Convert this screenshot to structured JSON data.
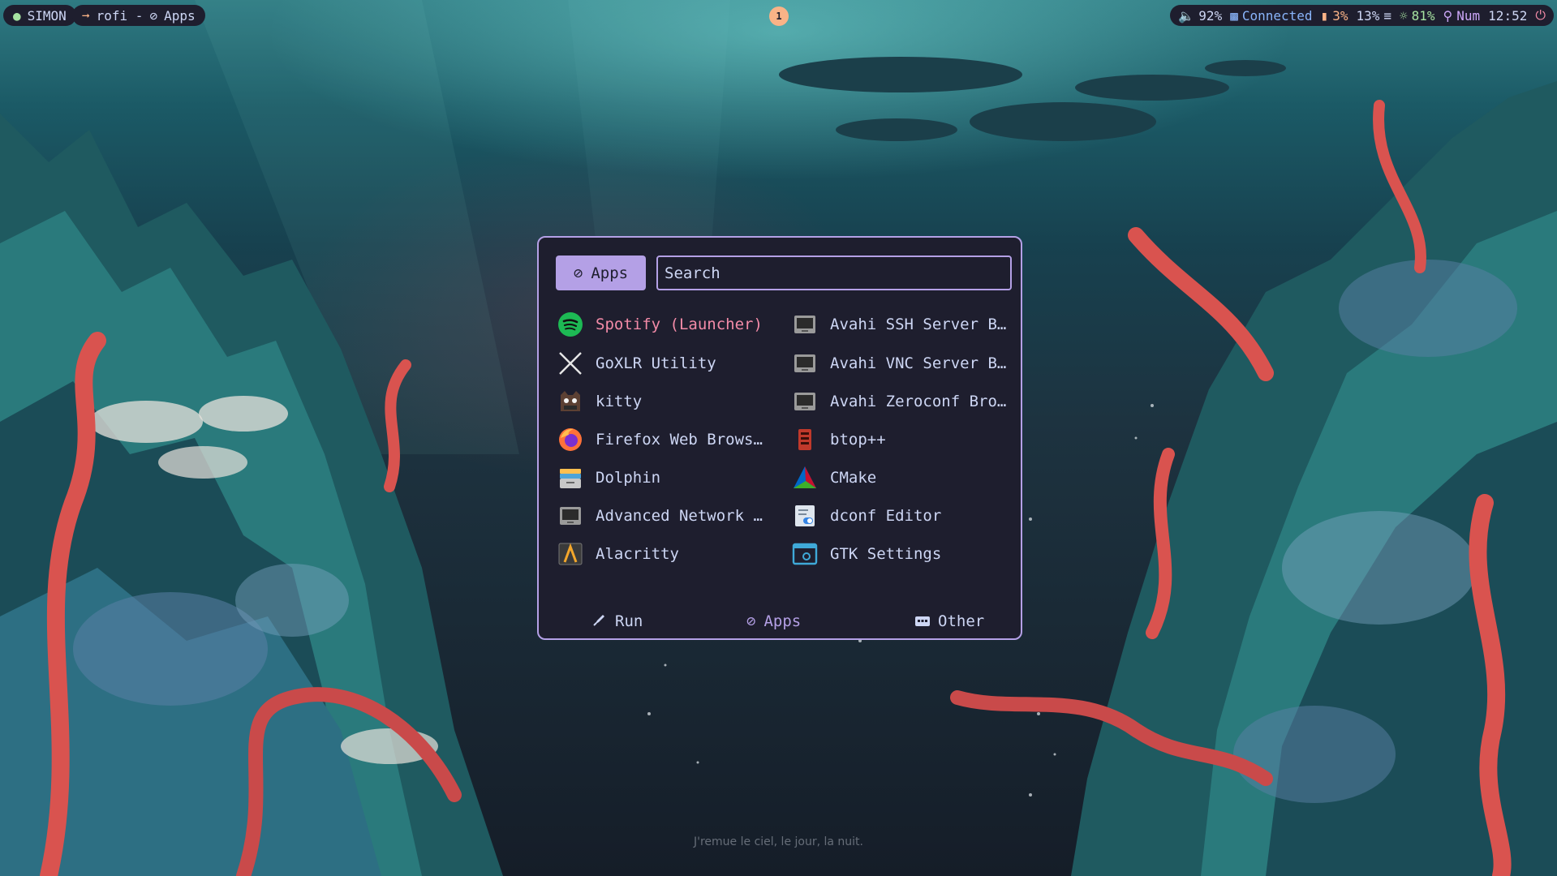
{
  "topbar": {
    "user": "SIMON",
    "window": {
      "prefix": "rofi -",
      "mode": "Apps"
    },
    "workspace": "1",
    "status": {
      "volume": "92%",
      "network": "Connected",
      "cpu": "3%",
      "memory": "13%",
      "brightness": "81%",
      "numlock": "Num",
      "clock": "12:52"
    }
  },
  "rofi": {
    "mode_label": "Apps",
    "search_placeholder": "Search",
    "apps_left": [
      {
        "label": "Spotify (Launcher)",
        "icon": "spotify-icon",
        "selected": true
      },
      {
        "label": "GoXLR Utility",
        "icon": "goxlr-icon"
      },
      {
        "label": "kitty",
        "icon": "kitty-icon"
      },
      {
        "label": "Firefox Web Browser",
        "icon": "firefox-icon"
      },
      {
        "label": "Dolphin",
        "icon": "dolphin-icon"
      },
      {
        "label": "Advanced Network Co…",
        "icon": "network-icon"
      },
      {
        "label": "Alacritty",
        "icon": "alacritty-icon"
      }
    ],
    "apps_right": [
      {
        "label": "Avahi SSH Server Br…",
        "icon": "avahi-icon"
      },
      {
        "label": "Avahi VNC Server Br…",
        "icon": "avahi-icon"
      },
      {
        "label": "Avahi Zeroconf Brow…",
        "icon": "avahi-icon"
      },
      {
        "label": "btop++",
        "icon": "btop-icon"
      },
      {
        "label": "CMake",
        "icon": "cmake-icon"
      },
      {
        "label": "dconf Editor",
        "icon": "dconf-icon"
      },
      {
        "label": "GTK Settings",
        "icon": "gtk-settings-icon"
      }
    ],
    "modes": [
      {
        "label": "Run",
        "icon": "rocket-icon"
      },
      {
        "label": "Apps",
        "icon": "apps-circle-icon",
        "active": true
      },
      {
        "label": "Other",
        "icon": "keyboard-icon"
      }
    ]
  },
  "wallpaper": {
    "quote": "J'remue le ciel, le jour, la nuit."
  },
  "colors": {
    "accent": "#b4a0e6",
    "selected": "#f38ba8",
    "background": "#1e1e2e",
    "text": "#cdd6f4"
  }
}
